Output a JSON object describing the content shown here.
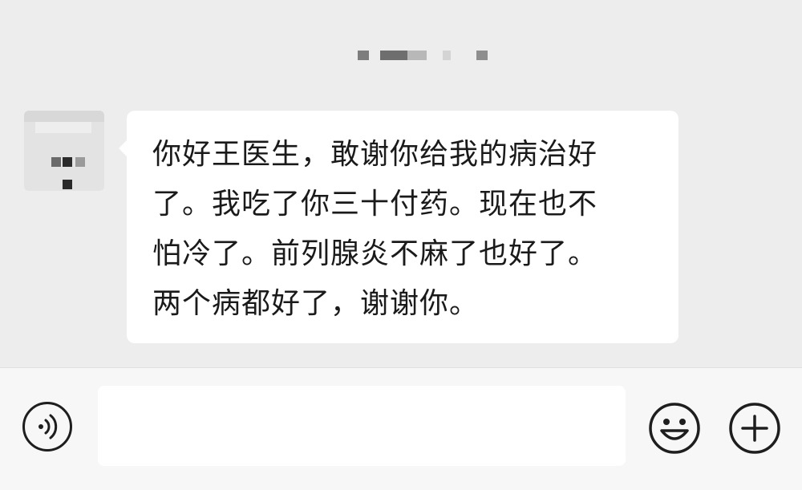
{
  "message": {
    "sender": "other",
    "lines": [
      "你好王医生，敢谢你给我的病治好",
      "了。我吃了你三十付药。现在也不",
      "怕冷了。前列腺炎不麻了也好了。",
      "两个病都好了，谢谢你。"
    ]
  },
  "input_bar": {
    "input_value": "",
    "voice_icon": "voice-icon",
    "emoji_icon": "emoji-icon",
    "plus_icon": "plus-icon"
  },
  "colors": {
    "chat_background": "#ededed",
    "bubble_background": "#ffffff",
    "input_bar_background": "#f7f7f7",
    "text": "#1a1a1a",
    "icon": "#1e1e1e"
  }
}
